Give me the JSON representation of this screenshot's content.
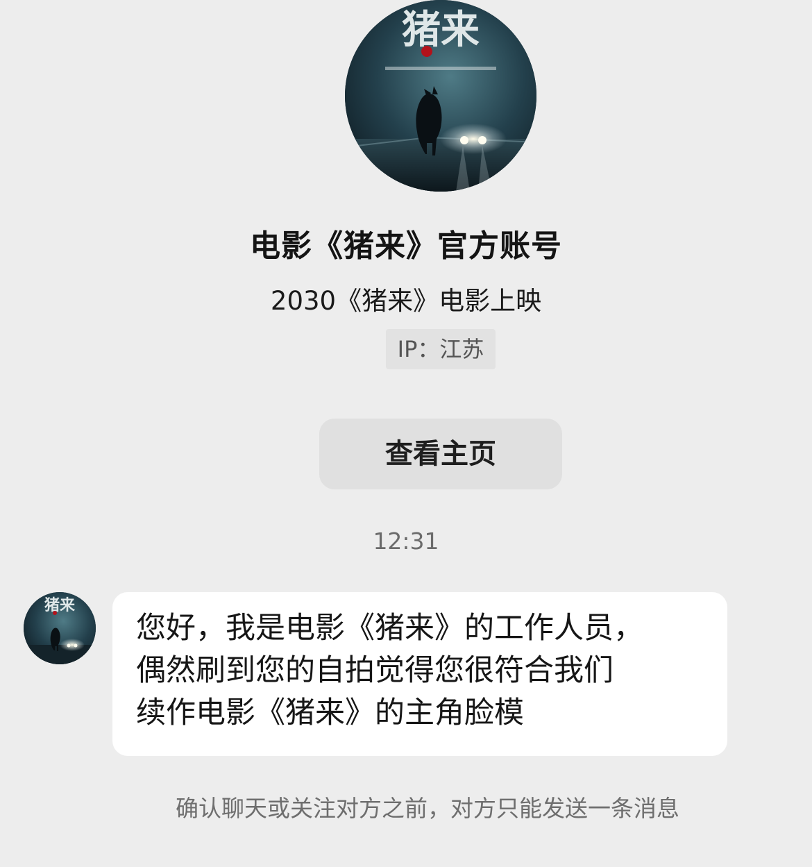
{
  "profile": {
    "avatar_title": "猪来",
    "name": "电影《猪来》官方账号",
    "bio": "2030《猪来》电影上映",
    "ip": "IP：江苏",
    "view_home_label": "查看主页"
  },
  "chat": {
    "timestamp": "12:31",
    "message_lines": [
      "您好，我是电影《猪来》的工作人员，",
      "偶然刷到您的自拍觉得您很符合我们",
      "续作电影《猪来》的主角脸模"
    ],
    "notice": "确认聊天或关注对方之前，对方只能发送一条消息"
  },
  "icons": {
    "avatar": "movie-poster-pig-icon"
  }
}
